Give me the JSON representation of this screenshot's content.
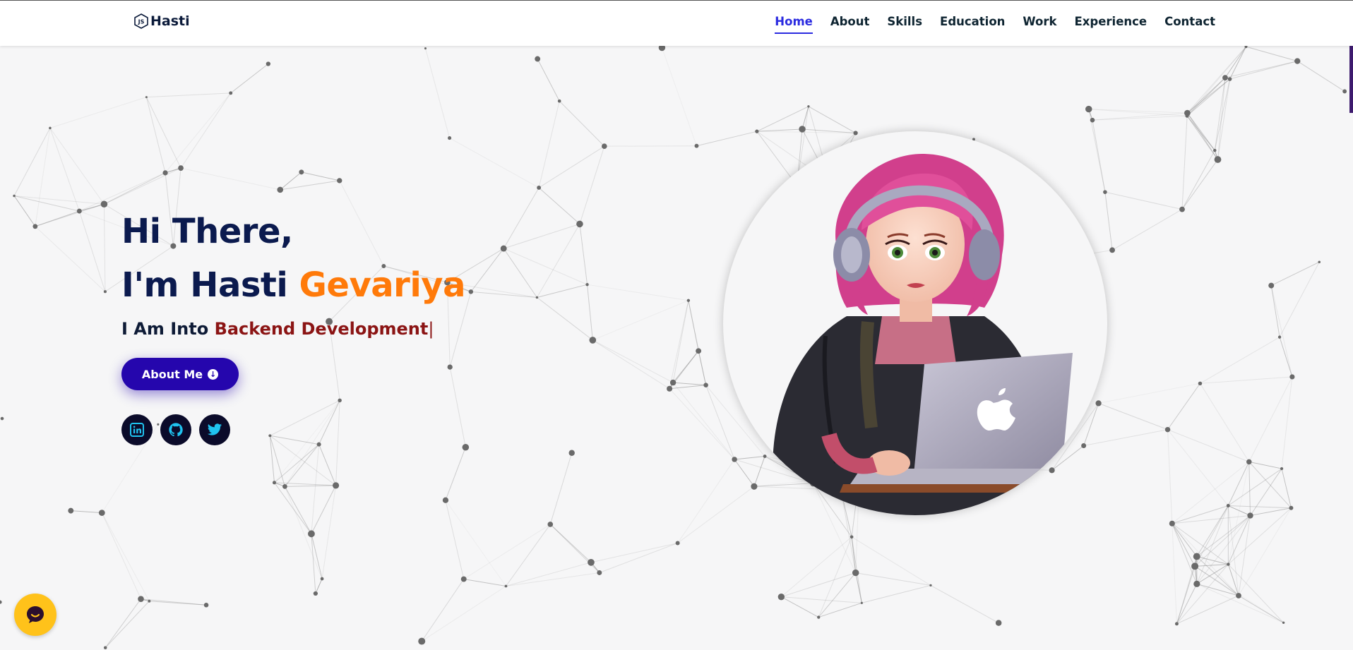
{
  "brand": {
    "name": "Hasti",
    "icon": "nodejs-hex-icon"
  },
  "nav": {
    "items": [
      "Home",
      "About",
      "Skills",
      "Education",
      "Work",
      "Experience",
      "Contact"
    ],
    "active": "Home"
  },
  "hero": {
    "line1": "Hi There,",
    "line2_prefix": "I'm Hasti ",
    "line2_accent": "Gevariya",
    "role_prefix": "I Am Into ",
    "role_typed": "Backend Development",
    "role_cursor": "|",
    "button_label": "About Me",
    "button_icon": "arrow-circle-down-icon"
  },
  "socials": [
    "linkedin-icon",
    "github-icon",
    "twitter-icon"
  ],
  "avatar": "girl-with-headphones-laptop",
  "chat_icon": "chat-bubble-icon",
  "colors": {
    "navy": "#0b1a4e",
    "accent_orange": "#ff7a0a",
    "role_red": "#8b1414",
    "button_blue": "#2506ad",
    "active_nav": "#2a2ae0",
    "social_bg": "#0b0b2a",
    "social_icon": "#1fc3f0",
    "chat_bg": "#ffc21a"
  }
}
